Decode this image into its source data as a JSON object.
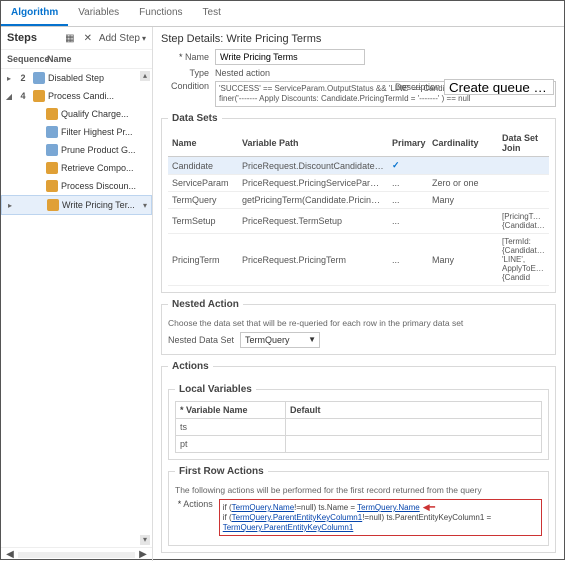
{
  "tabs": {
    "t0": "Algorithm",
    "t1": "Variables",
    "t2": "Functions",
    "t3": "Test"
  },
  "left": {
    "title": "Steps",
    "addStep": "Add Step",
    "col_seq": "Sequence",
    "col_name": "Name",
    "items": [
      {
        "seq": "2",
        "tg": "▸",
        "name": "Disabled Step",
        "ic": "chain"
      },
      {
        "seq": "4",
        "tg": "◢",
        "name": "Process Candi...",
        "ic": "cube"
      },
      {
        "seq": "",
        "tg": "",
        "name": "Qualify Charge...",
        "ic": "cube",
        "indent": true
      },
      {
        "seq": "",
        "tg": "",
        "name": "Filter Highest Pr...",
        "ic": "chain",
        "indent": true
      },
      {
        "seq": "",
        "tg": "",
        "name": "Prune Product G...",
        "ic": "chain",
        "indent": true
      },
      {
        "seq": "",
        "tg": "",
        "name": "Retrieve Compo...",
        "ic": "cube",
        "indent": true
      },
      {
        "seq": "",
        "tg": "",
        "name": "Process Discoun...",
        "ic": "cube",
        "indent": true
      },
      {
        "seq": "",
        "tg": "▸",
        "name": "Write Pricing Ter...",
        "ic": "cube",
        "indent": true,
        "selected": true
      }
    ]
  },
  "details": {
    "title": "Step Details: Write Pricing Terms",
    "name_lbl": "Name",
    "name_val": "Write Pricing Terms",
    "type_lbl": "Type",
    "type_val": "Nested action",
    "desc_lbl": "Description",
    "desc_val": "Create queue of discour",
    "cond_lbl": "Condition",
    "cond_val": "'SUCCESS' == ServiceParam.OutputStatus && 'LINE' == Candidate.ParentEntityCode && finer('------- Apply Discounts: Candidate.PricingTermId = '-------' ) == null"
  },
  "datasets": {
    "legend": "Data Sets",
    "head": {
      "c0": "Name",
      "c1": "Variable Path",
      "c2": "Primary",
      "c3": "Cardinality",
      "c4": "Data Set Join"
    },
    "rows": [
      {
        "n": "Candidate",
        "v": "PriceRequest.DiscountCandidate",
        "p": "✓",
        "c": "",
        "j": "",
        "sel": true,
        "edit": true
      },
      {
        "n": "ServiceParam",
        "v": "PriceRequest.PricingServiceParameter",
        "p": "...",
        "c": "Zero or one",
        "j": ""
      },
      {
        "n": "TermQuery",
        "v": "getPricingTerm(Candidate.PricingTerm",
        "p": "...",
        "c": "Many",
        "j": ""
      },
      {
        "n": "TermSetup",
        "v": "PriceRequest.TermSetup",
        "p": "...",
        "c": "",
        "j": "[PricingTermId:{Candidate.Pricin"
      },
      {
        "n": "PricingTerm",
        "v": "PriceRequest.PricingTerm",
        "p": "...",
        "c": "Many",
        "j": "[TermId: {Candidate.PricingTerm 'LINE', ApplyToEntityId: {Candid"
      }
    ]
  },
  "nested": {
    "legend": "Nested Action",
    "note": "Choose the data set that will be re-queried for each row in the primary data set",
    "lbl": "Nested Data Set",
    "val": "TermQuery"
  },
  "actions": {
    "legend": "Actions",
    "localVars": {
      "legend": "Local Variables",
      "h0": "Variable Name",
      "h1": "Default",
      "rows": [
        "ts",
        "pt"
      ]
    },
    "firstRow": {
      "legend": "First Row Actions",
      "note": "The following actions will be performed for the first record returned from the query",
      "lbl": "Actions",
      "line1_a": "if (",
      "line1_b": "TermQuery.Name",
      "line1_c": "!=null) ts.Name = ",
      "line1_d": "TermQuery.Name",
      "line2_a": "if (",
      "line2_b": "TermQuery.ParentEntityKeyColumn1",
      "line2_c": "!=null) ts.ParentEntityKeyColumn1 = ",
      "line2_d": "TermQuery.ParentEntityKeyColumn1"
    }
  }
}
